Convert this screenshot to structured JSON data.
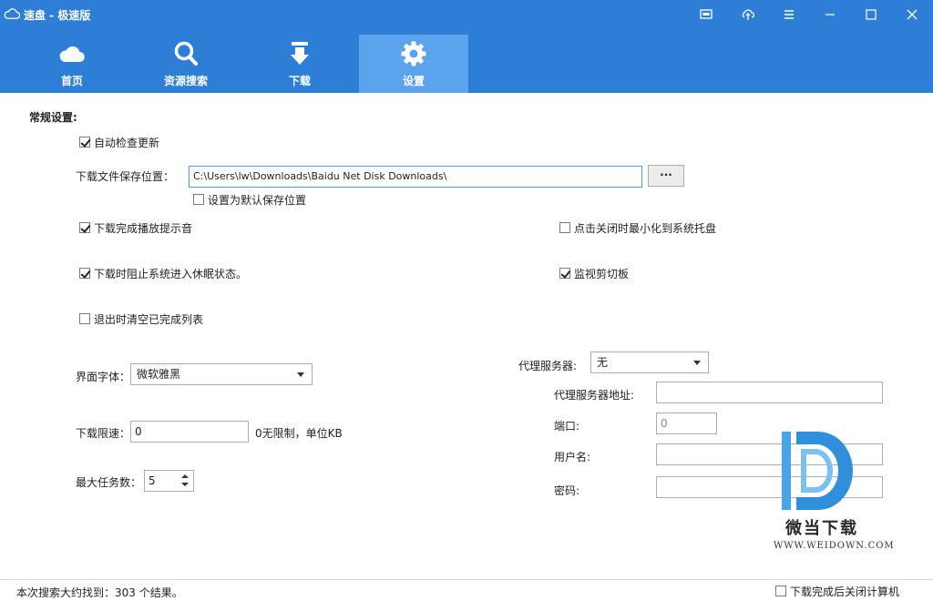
{
  "window": {
    "title": "速盘 - 极速版",
    "icons": [
      "cloud-icon",
      "skin-icon",
      "upload-icon",
      "menu-icon",
      "minimize-icon",
      "maximize-icon",
      "close-icon"
    ],
    "accent_color": "#2d7fd6"
  },
  "tabs": [
    {
      "label": "首页",
      "icon": "cloud-icon",
      "active": false
    },
    {
      "label": "资源搜索",
      "icon": "search-icon",
      "active": false
    },
    {
      "label": "下载",
      "icon": "download-icon",
      "active": false
    },
    {
      "label": "设置",
      "icon": "gear-icon",
      "active": true
    }
  ],
  "settings": {
    "section_title": "常规设置:",
    "auto_update": {
      "label": "自动检查更新",
      "checked": true
    },
    "save_path": {
      "label": "下载文件保存位置：",
      "value": "C:\\Users\\lw\\Downloads\\Baidu Net Disk Downloads\\",
      "browse_label": "···"
    },
    "default_path": {
      "label": "设置为默认保存位置",
      "checked": false
    },
    "play_sound": {
      "label": "下载完成播放提示音",
      "checked": true
    },
    "minimize_tray": {
      "label": "点击关闭时最小化到系统托盘",
      "checked": false
    },
    "prevent_sleep": {
      "label": "下载时阻止系统进入休眠状态。",
      "checked": true
    },
    "monitor_clipboard": {
      "label": "监视剪切板",
      "checked": true
    },
    "clear_on_exit": {
      "label": "退出时清空已完成列表",
      "checked": false
    },
    "font": {
      "label": "界面字体：",
      "value": "微软雅黑"
    },
    "speed_limit": {
      "label": "下载限速：",
      "value": "0",
      "hint": "0无限制，单位KB"
    },
    "max_tasks": {
      "label": "最大任务数：",
      "value": "5"
    },
    "proxy": {
      "label": "代理服务器:",
      "value": "无",
      "address_label": "代理服务器地址:",
      "address_value": "",
      "port_label": "端口:",
      "port_value": "0",
      "user_label": "用户名:",
      "user_value": "",
      "password_label": "密码:",
      "password_value": ""
    }
  },
  "watermark": {
    "text": "微当下载",
    "url": "WWW.WEIDOWN.COM"
  },
  "status": {
    "search_result": "本次搜索大约找到：303 个结果。",
    "shutdown": {
      "label": "下载完成后关闭计算机",
      "checked": false
    }
  }
}
